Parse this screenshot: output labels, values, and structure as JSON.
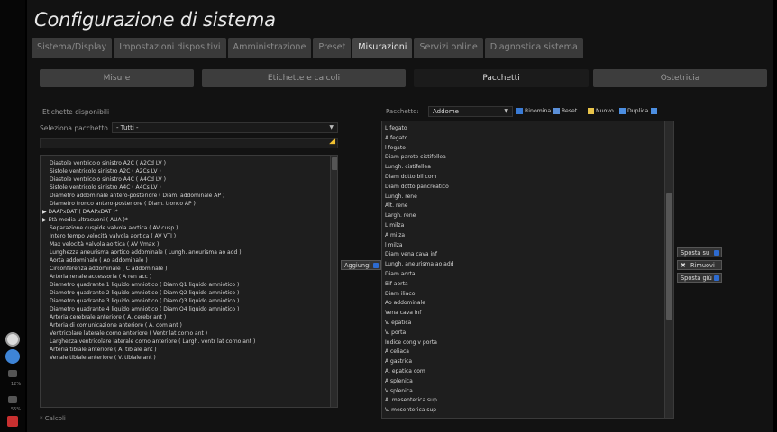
{
  "app": {
    "title": "Configurazione di sistema"
  },
  "tabs": [
    {
      "label": "Sistema/Display"
    },
    {
      "label": "Impostazioni dispositivi"
    },
    {
      "label": "Amministrazione"
    },
    {
      "label": "Preset"
    },
    {
      "label": "Misurazioni",
      "active": true
    },
    {
      "label": "Servizi online"
    },
    {
      "label": "Diagnostica sistema"
    }
  ],
  "subtabs": [
    {
      "label": "Misure"
    },
    {
      "label": "Etichette e calcoli"
    },
    {
      "label": "Pacchetti",
      "active": true
    },
    {
      "label": "Ostetricia"
    }
  ],
  "left": {
    "title": "Etichette disponibili",
    "package_label": "Seleziona pacchetto",
    "package_value": "- Tutti -",
    "footnote": "* Calcoli",
    "items": [
      {
        "text": "Diastole ventricolo sinistro A2C ( A2Cd LV )"
      },
      {
        "text": "Sistole ventricolo sinistro A2C ( A2Cs LV )"
      },
      {
        "text": "Diastole ventricolo sinistro A4C ( A4Cd LV )"
      },
      {
        "text": "Sistole ventricolo sinistro A4C ( A4Cs LV )"
      },
      {
        "text": "Diametro addominale antero-posteriore ( Diam. addominale AP )"
      },
      {
        "text": "Diametro tronco antero-posteriore ( Diam. tronco AP )"
      },
      {
        "text": "DAAPxDAT ( DAAPxDAT )*",
        "expand": true
      },
      {
        "text": "Età media ultrasuoni ( AUA )*",
        "expand": true
      },
      {
        "text": "Separazione cuspide valvola aortica ( AV cusp )"
      },
      {
        "text": "Intero tempo velocità valvola aortica ( AV VTI )"
      },
      {
        "text": "Max velocità valvola aortica ( AV Vmax )"
      },
      {
        "text": "Lunghezza aneurisma aortico addominale ( Lungh. aneurisma ao add )"
      },
      {
        "text": "Aorta addominale ( Ao addominale )"
      },
      {
        "text": "Circonferenza addominale ( C addominale )"
      },
      {
        "text": "Arteria renale accessoria ( A ren acc )"
      },
      {
        "text": "Diametro quadrante 1 liquido amniotico ( Diam Q1 liquido amniotico )"
      },
      {
        "text": "Diametro quadrante 2 liquido amniotico ( Diam Q2 liquido amniotico )"
      },
      {
        "text": "Diametro quadrante 3 liquido amniotico ( Diam Q3 liquido amniotico )"
      },
      {
        "text": "Diametro quadrante 4 liquido amniotico ( Diam Q4 liquido amniotico )"
      },
      {
        "text": "Arteria cerebrale anteriore ( A. cerebr ant )"
      },
      {
        "text": "Arteria di comunicazione anteriore ( A. com ant )"
      },
      {
        "text": "Ventricolare laterale corno anteriore ( Ventr lat corno ant )"
      },
      {
        "text": "Larghezza ventricolare laterale corno anteriore ( Largh. ventr lat corno ant )"
      },
      {
        "text": "Arteria tibiale anteriore ( A. tibiale ant )"
      },
      {
        "text": "Venale tibiale anteriore ( V. tibiale ant )"
      }
    ]
  },
  "middle": {
    "add_label": "Aggiungi"
  },
  "right": {
    "package_label": "Pacchetto:",
    "package_value": "Addome",
    "toolbar": [
      {
        "label": "Rinomina",
        "color": "#3a7bd5"
      },
      {
        "label": "Reset",
        "color": "#5a8fd8"
      },
      {
        "label": "Nuovo",
        "color": "#e8c34a"
      },
      {
        "label": "Duplica",
        "color": "#4c8ee0"
      }
    ],
    "items": [
      "L fegato",
      "A fegato",
      "l fegato",
      "Diam parete cistifellea",
      "Lungh. cistifellea",
      "Diam dotto bil com",
      "Diam dotto pancreatico",
      "Lungh. rene",
      "Alt. rene",
      "Largh. rene",
      "L milza",
      "A milza",
      "l milza",
      "Diam vena cava inf",
      "Lungh. aneurisma ao add",
      "Diam aorta",
      "Bif aorta",
      "Diam iliaco",
      "Ao addominale",
      "Vena cava inf",
      "V. epatica",
      "V. porta",
      "Indice cong v porta",
      "A celiaca",
      "A gastrica",
      "A. epatica com",
      "A splenica",
      "V splenica",
      "A. mesenterica sup",
      "V. mesenterica sup"
    ]
  },
  "actions": {
    "up": "Sposta su",
    "remove": "Rimuovi",
    "down": "Sposta giù"
  },
  "sidebar": {
    "badge_1": "12%",
    "badge_2": "55%"
  },
  "colors": {
    "accent": "#2d6bd0",
    "pencil": "#f0c030"
  }
}
